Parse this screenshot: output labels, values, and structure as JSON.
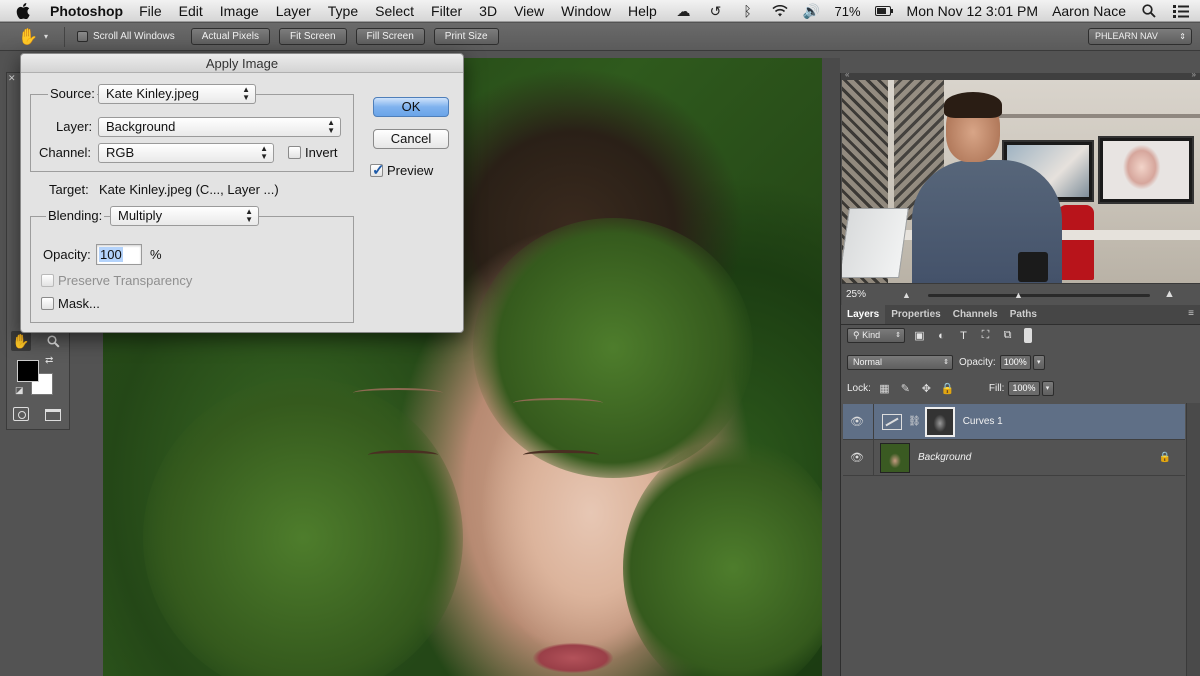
{
  "menubar": {
    "app_name": "Photoshop",
    "items": [
      "File",
      "Edit",
      "Image",
      "Layer",
      "Type",
      "Select",
      "Filter",
      "3D",
      "View",
      "Window",
      "Help"
    ],
    "battery": "71%",
    "datetime": "Mon Nov 12  3:01 PM",
    "user": "Aaron Nace"
  },
  "options_bar": {
    "scroll_all_windows": "Scroll All Windows",
    "buttons": [
      "Actual Pixels",
      "Fit Screen",
      "Fill Screen",
      "Print Size"
    ],
    "workspace": "PHLEARN NAV"
  },
  "dialog": {
    "title": "Apply Image",
    "source_label": "Source:",
    "source_value": "Kate Kinley.jpeg",
    "layer_label": "Layer:",
    "layer_value": "Background",
    "channel_label": "Channel:",
    "channel_value": "RGB",
    "invert_label": "Invert",
    "target_label": "Target:",
    "target_value": "Kate Kinley.jpeg (C..., Layer ...)",
    "blending_label": "Blending:",
    "blending_value": "Multiply",
    "opacity_label": "Opacity:",
    "opacity_value": "100",
    "opacity_unit": "%",
    "preserve_transparency": "Preserve Transparency",
    "mask_label": "Mask...",
    "ok": "OK",
    "cancel": "Cancel",
    "preview": "Preview",
    "preview_checked": true
  },
  "navigator": {
    "zoom": "25%"
  },
  "layers_panel": {
    "tabs": [
      "Layers",
      "Properties",
      "Channels",
      "Paths"
    ],
    "active_tab": "Layers",
    "filter_kind": "Kind",
    "blend_mode": "Normal",
    "opacity_label": "Opacity:",
    "opacity_value": "100%",
    "lock_label": "Lock:",
    "fill_label": "Fill:",
    "fill_value": "100%",
    "layers": [
      {
        "name": "Curves 1",
        "selected": true
      },
      {
        "name": "Background",
        "selected": false,
        "locked": true
      }
    ]
  },
  "colors": {
    "selected_layer": "#5f6f86",
    "default_button": "#7fb2ee"
  }
}
